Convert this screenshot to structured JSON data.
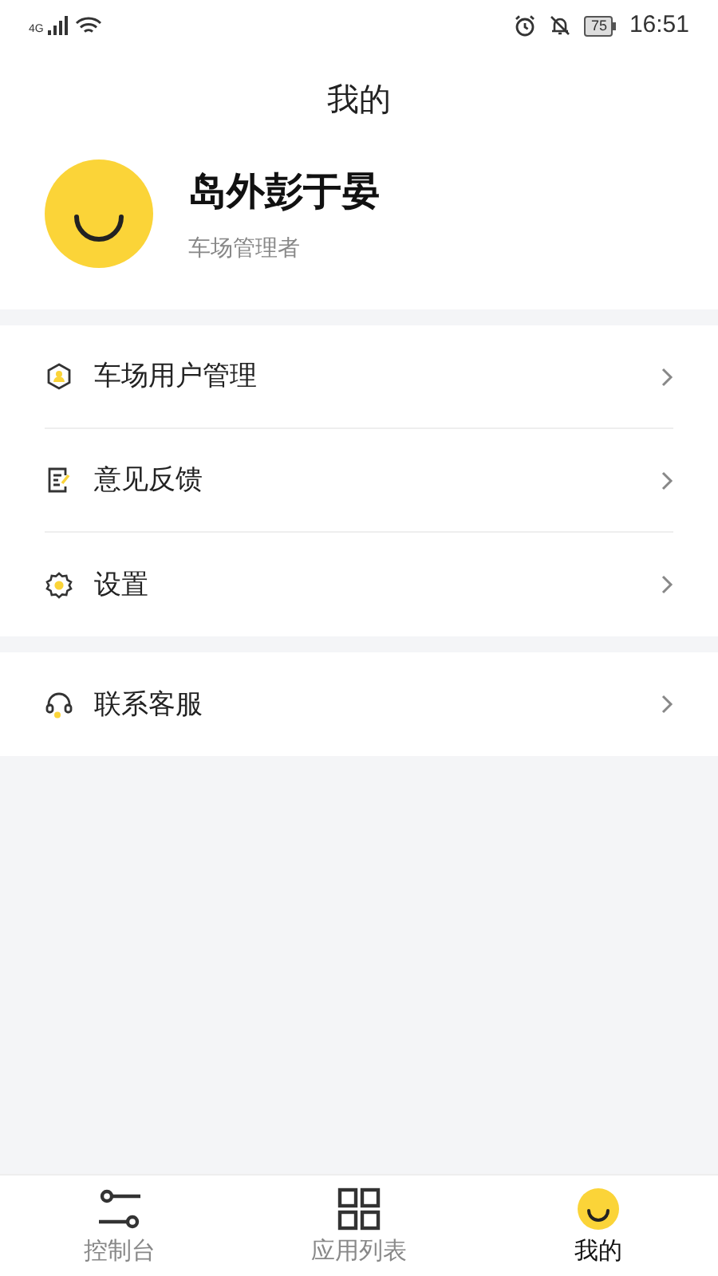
{
  "status_bar": {
    "network": "4G",
    "battery": "75",
    "time": "16:51"
  },
  "header": {
    "title": "我的"
  },
  "profile": {
    "name": "岛外彭于晏",
    "role": "车场管理者"
  },
  "sections": [
    {
      "items": [
        {
          "kind": "user",
          "label": "车场用户管理"
        },
        {
          "kind": "feedback",
          "label": "意见反馈"
        },
        {
          "kind": "settings",
          "label": "设置"
        }
      ]
    },
    {
      "items": [
        {
          "kind": "service",
          "label": "联系客服"
        }
      ]
    }
  ],
  "tab_bar": [
    {
      "kind": "console",
      "label": "控制台",
      "selected": false
    },
    {
      "kind": "apps",
      "label": "应用列表",
      "selected": false
    },
    {
      "kind": "mine",
      "label": "我的",
      "selected": true
    }
  ]
}
